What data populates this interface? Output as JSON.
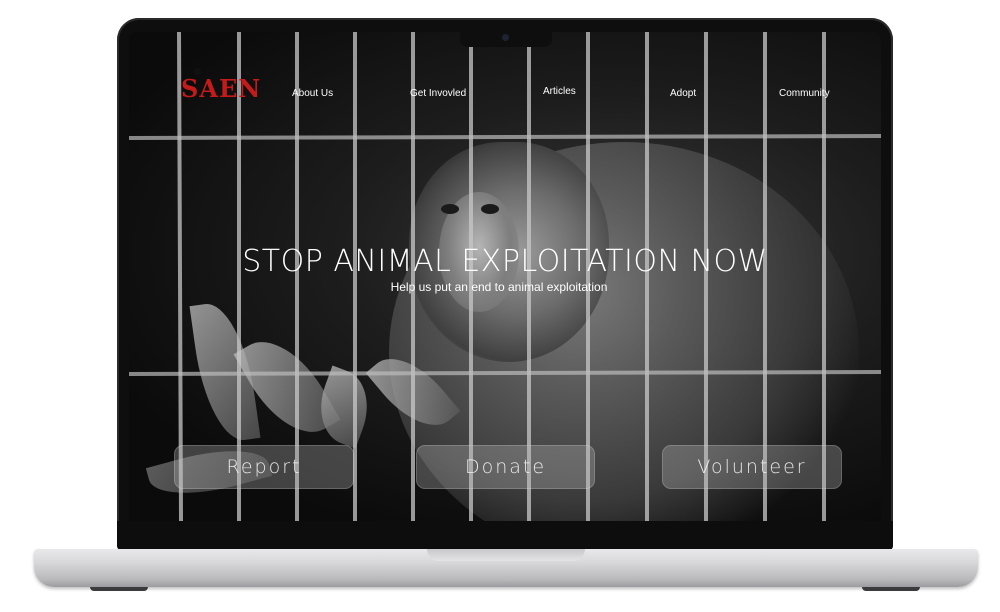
{
  "site": {
    "logo_text": "SAEN",
    "logo_icons": [
      "monkey-silhouette",
      "cat-silhouette"
    ]
  },
  "nav": {
    "items": [
      {
        "label": "About Us"
      },
      {
        "label": "Get Invovled"
      },
      {
        "label": "Articles"
      },
      {
        "label": "Adopt"
      },
      {
        "label": "Community"
      }
    ]
  },
  "hero": {
    "title": "STOP ANIMAL EXPLOITATION NOW",
    "subtitle": "Help us put an end to animal exploitation",
    "background": "caged-monkey-photo-grayscale"
  },
  "actions": {
    "report_label": "Report",
    "donate_label": "Donate",
    "volunteer_label": "Volunteer"
  },
  "colors": {
    "logo_red": "#c41a1a",
    "text_white": "#ffffff",
    "laptop_silver": "#d8d8da",
    "bezel_black": "#0e0e0e"
  }
}
